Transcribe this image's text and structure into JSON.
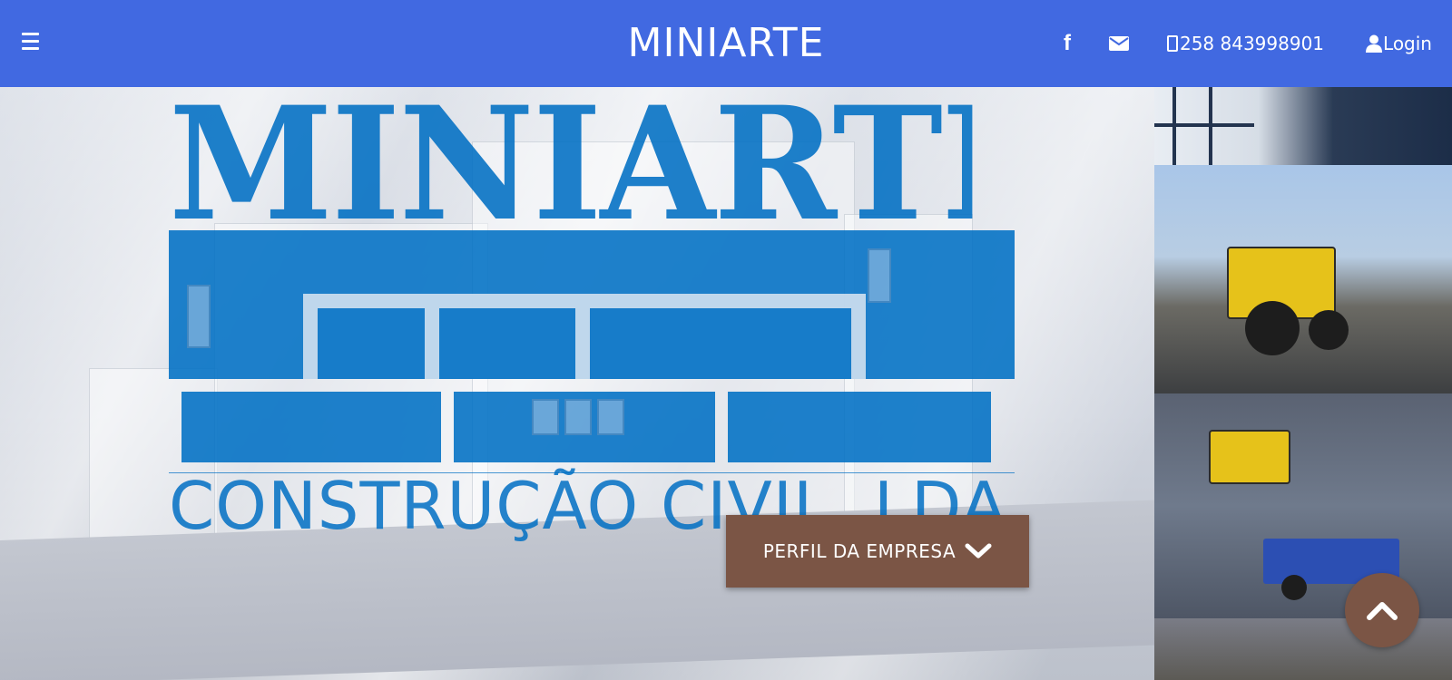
{
  "header": {
    "brand": "MINIARTE",
    "menu_icon": "hamburger-icon",
    "facebook_icon": "facebook-icon",
    "email_icon": "envelope-icon",
    "phone_icon": "mobile-phone-icon",
    "phone": "258 843998901",
    "login_icon": "user-icon",
    "login": "Login",
    "background_color": "#4169e1"
  },
  "hero": {
    "logo_title": "MINIARTE",
    "logo_subtitle": "CONSTRUÇÃO CIVIL, LDA",
    "logo_color": "#0070c4",
    "cta_label": "PERFIL DA EMPRESA",
    "cta_icon": "chevron-down-icon",
    "cta_color": "#7b5545"
  },
  "scroll_top": {
    "icon": "chevron-up-icon",
    "color": "#7b5545"
  }
}
